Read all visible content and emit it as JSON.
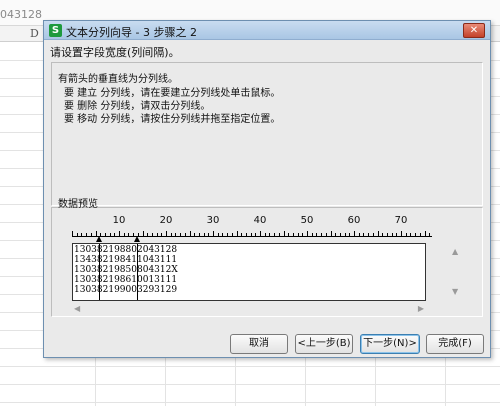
{
  "sheet": {
    "cell_value_fragment": "043128",
    "column_letter": "D"
  },
  "dialog": {
    "title": "文本分列向导 - 3 步骤之 2",
    "app_icon_letter": "S",
    "close_glyph": "✕",
    "instruction": "请设置字段宽度(列间隔)。",
    "help_lines": [
      "有箭头的垂直线为分列线。",
      "要 建立 分列线，请在要建立分列线处单击鼠标。",
      "要 删除 分列线，请双击分列线。",
      "要 移动 分列线，请按住分列线并拖至指定位置。"
    ],
    "preview_label": "数据预览",
    "ruler_labels": [
      "10",
      "20",
      "30",
      "40",
      "50",
      "60",
      "70"
    ],
    "preview_rows": [
      "130382198802043128",
      "134382198411043111",
      "13038219850804312X",
      "130382198610013111",
      "130382199003293129"
    ],
    "column_breaks": [
      6,
      14
    ],
    "scroll_glyphs": {
      "up": "▲",
      "down": "▼",
      "left": "◀",
      "right": "▶"
    },
    "buttons": {
      "cancel": "取消",
      "back": "<上一步(B)",
      "next": "下一步(N)>",
      "finish": "完成(F)"
    }
  }
}
